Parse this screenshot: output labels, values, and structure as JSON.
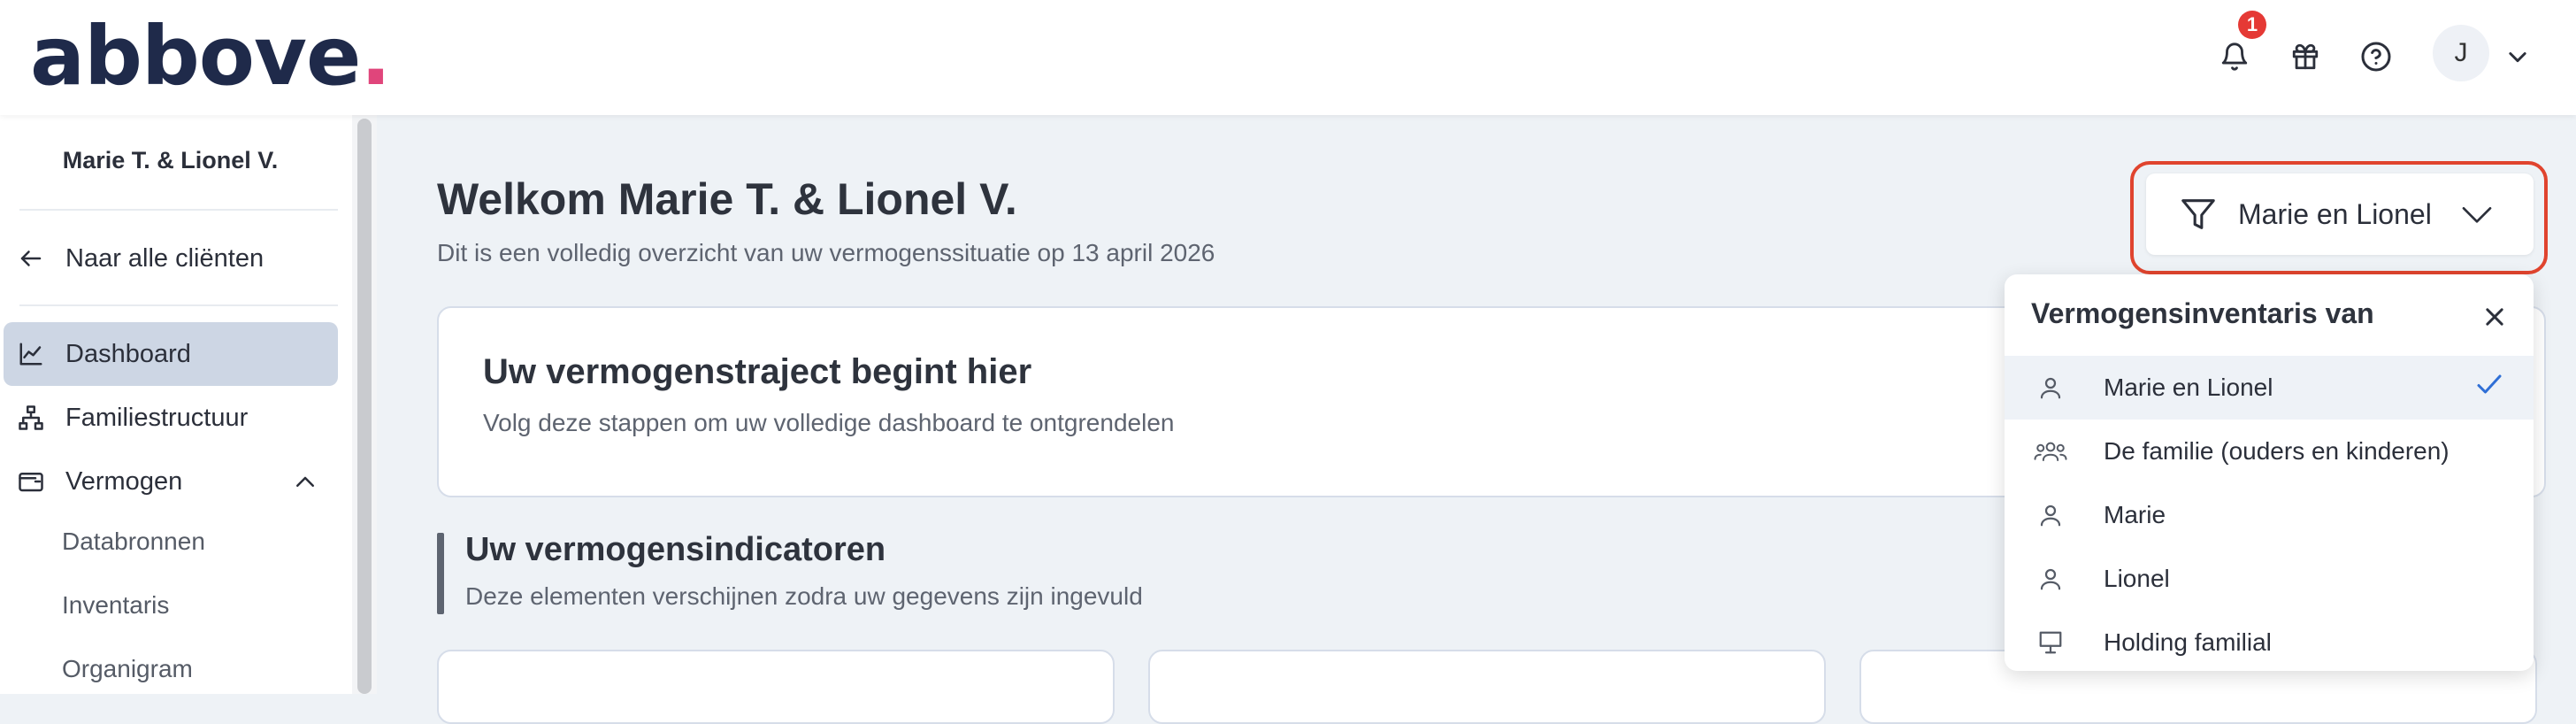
{
  "header": {
    "logo_text": "abbove",
    "logo_dot": ".",
    "notification_count": "1",
    "avatar_initial": "J",
    "brand_color": "#1f2a4a",
    "accent_dot_color": "#e0457b",
    "badge_color": "#e53935"
  },
  "sidebar": {
    "client_name": "Marie T. & Lionel V.",
    "back_link": "Naar alle cliënten",
    "items": [
      {
        "label": "Dashboard",
        "icon": "chart-line-icon",
        "active": true
      },
      {
        "label": "Familiestructuur",
        "icon": "hierarchy-icon"
      },
      {
        "label": "Vermogen",
        "icon": "wallet-icon",
        "expanded": true
      }
    ],
    "sub_items": [
      "Databronnen",
      "Inventaris",
      "Organigram"
    ]
  },
  "main": {
    "title": "Welkom Marie T. & Lionel V.",
    "subtitle": "Dit is een volledig overzicht van uw vermogenssituatie op 13 april 2026",
    "card": {
      "title": "Uw vermogenstraject begint hier",
      "text": "Volg deze stappen om uw volledige dashboard te ontgrendelen"
    },
    "section": {
      "title": "Uw vermogensindicatoren",
      "subtitle": "Deze elementen verschijnen zodra uw gegevens zijn ingevuld"
    }
  },
  "filter": {
    "selected_label": "Marie en Lionel",
    "highlight_color": "#e0442e"
  },
  "dropdown": {
    "title": "Vermogensinventaris van",
    "options": [
      {
        "label": "Marie en Lionel",
        "icon": "person-icon",
        "selected": true
      },
      {
        "label": "De familie (ouders en kinderen)",
        "icon": "group-icon"
      },
      {
        "label": "Marie",
        "icon": "person-icon"
      },
      {
        "label": "Lionel",
        "icon": "person-icon"
      },
      {
        "label": "Holding familial",
        "icon": "presentation-icon"
      }
    ],
    "check_color": "#2f6fd6"
  }
}
